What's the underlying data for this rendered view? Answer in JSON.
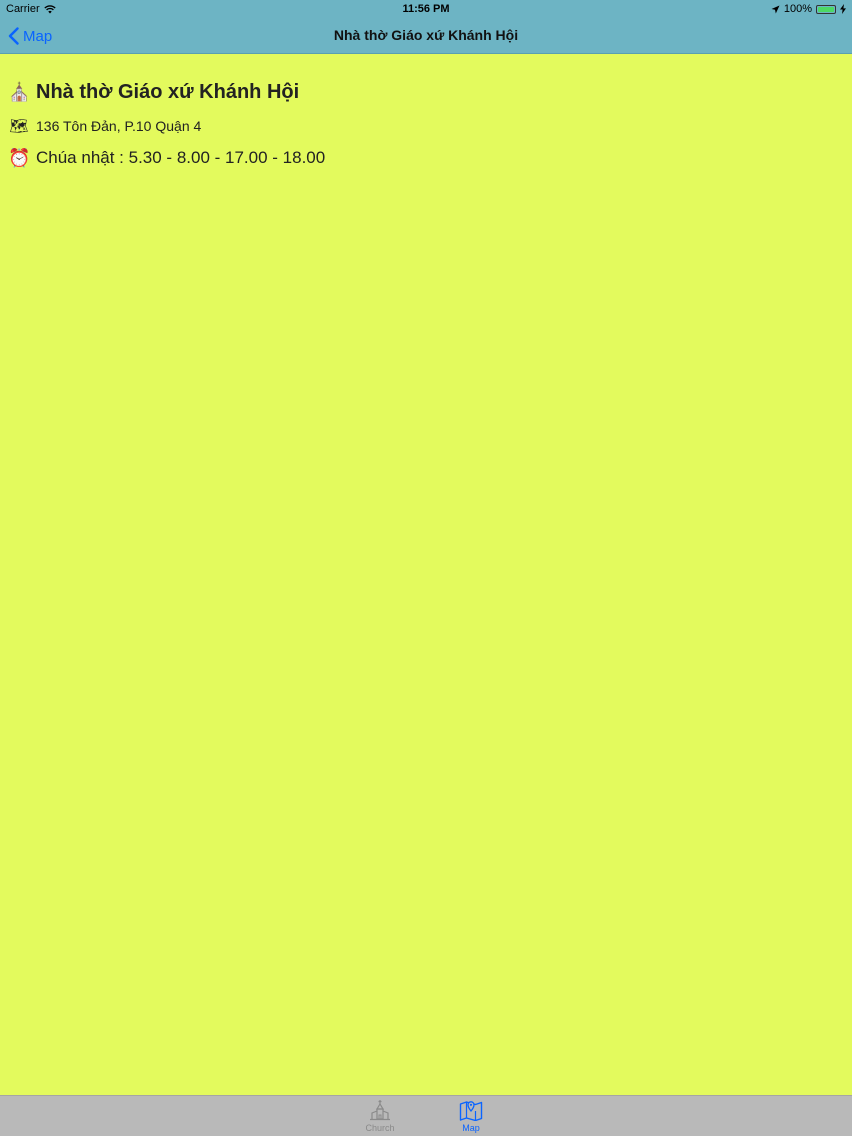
{
  "status": {
    "carrier": "Carrier",
    "time": "11:56 PM",
    "battery": "100%",
    "battery_level": 1.0
  },
  "nav": {
    "back_label": "Map",
    "title": "Nhà thờ Giáo xứ Khánh Hội"
  },
  "detail": {
    "church_icon": "⛪",
    "name": "Nhà thờ Giáo xứ Khánh Hội",
    "address_icon": "🗺",
    "address": "136 Tôn Đản, P.10 Quận 4",
    "schedule_icon": "⏰",
    "schedule": "Chúa nhật : 5.30 - 8.00 - 17.00 - 18.00"
  },
  "tabs": [
    {
      "label": "Church",
      "icon": "church-icon",
      "selected": false
    },
    {
      "label": "Map",
      "icon": "map-icon",
      "selected": true
    }
  ],
  "colors": {
    "background": "#e3fa5d",
    "bar": "#6db4c4",
    "accent": "#0a64ff",
    "tab_bar": "#b9b9b9"
  }
}
